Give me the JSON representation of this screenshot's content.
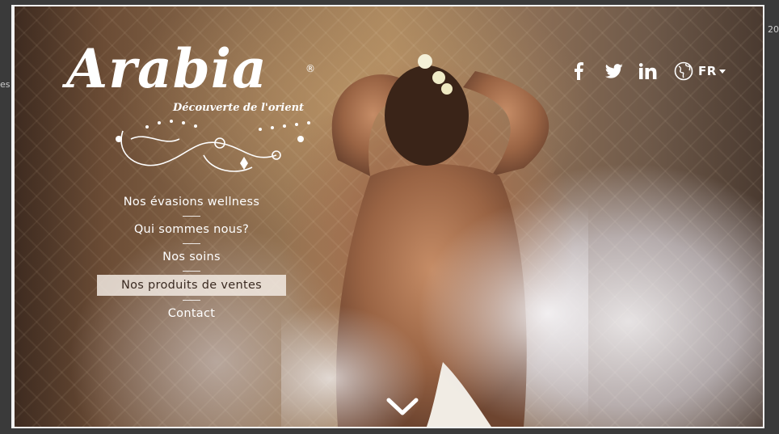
{
  "logo": {
    "name": "Arabia",
    "registered": "®",
    "tagline": "Découverte de l'orient"
  },
  "menu": {
    "items": [
      {
        "label": "Nos évasions wellness",
        "active": false
      },
      {
        "label": "Qui sommes nous?",
        "active": false
      },
      {
        "label": "Nos soins",
        "active": false
      },
      {
        "label": "Nos produits de ventes",
        "active": true
      },
      {
        "label": "Contact",
        "active": false
      }
    ]
  },
  "social": {
    "facebook_icon": "facebook-icon",
    "twitter_icon": "twitter-icon",
    "linkedin_icon": "linkedin-icon"
  },
  "language": {
    "icon": "globe-icon",
    "current": "FR"
  },
  "scroll": {
    "icon": "chevron-down-icon"
  },
  "edge": {
    "left_fragment": "es",
    "right_fragment": "20"
  },
  "colors": {
    "text": "#ffffff",
    "active_bg": "#f5eee6",
    "active_text": "#3b2b22"
  }
}
